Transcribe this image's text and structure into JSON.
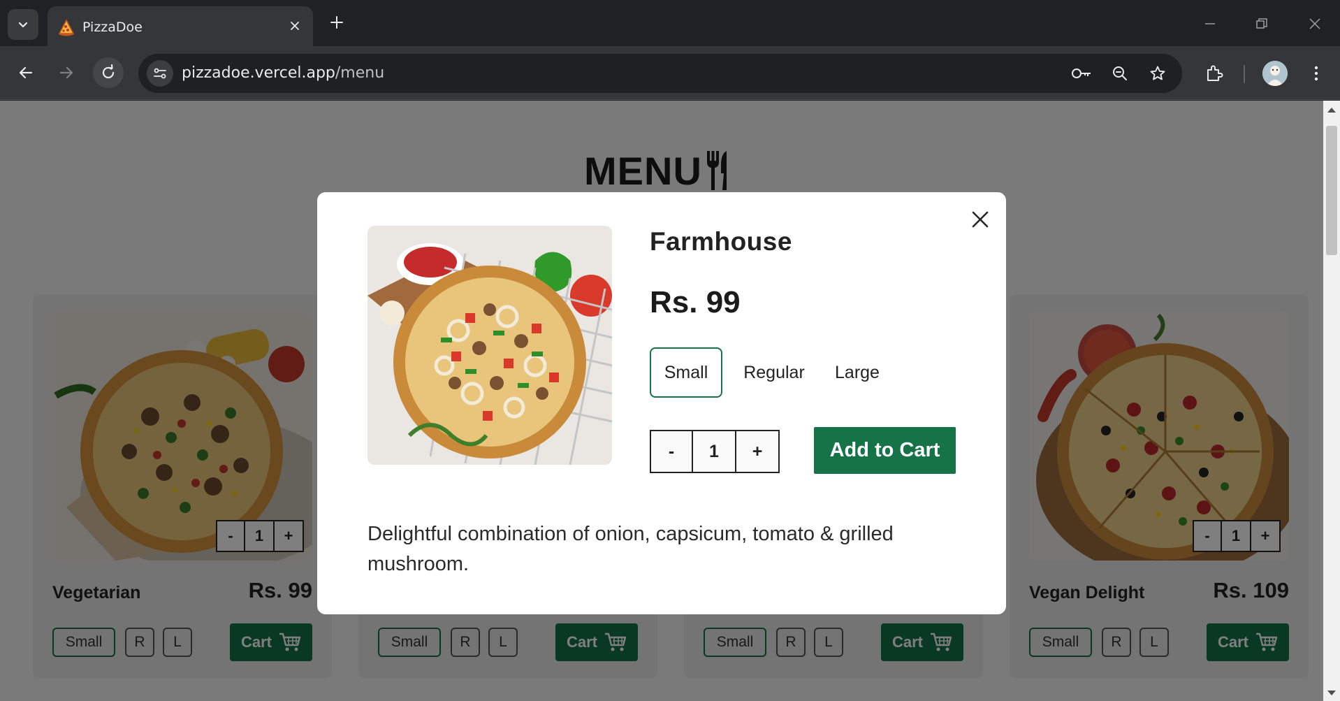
{
  "browser": {
    "tab_title": "PizzaDoe",
    "url_domain": "pizzadoe.vercel.app",
    "url_path": "/menu",
    "icons": [
      "tab-list-icon",
      "pizza-favicon",
      "close-icon",
      "plus-icon",
      "minimize-icon",
      "restore-icon",
      "window-close-icon",
      "back-arrow-icon",
      "forward-arrow-icon",
      "reload-icon",
      "site-settings-icon",
      "key-icon",
      "zoom-icon",
      "star-icon",
      "extensions-icon",
      "kebab-menu-icon"
    ]
  },
  "page": {
    "heading": "MENU",
    "heading_icon": "fork-knife-icon"
  },
  "cards": [
    {
      "name": "Vegetarian",
      "price": "Rs. 99",
      "qty": "1",
      "minus": "-",
      "plus": "+",
      "size_small": "Small",
      "size_r": "R",
      "size_l": "L",
      "cart": "Cart"
    },
    {
      "name": "",
      "price": "",
      "qty": "",
      "minus": "",
      "plus": "",
      "size_small": "Small",
      "size_r": "R",
      "size_l": "L",
      "cart": "Cart"
    },
    {
      "name": "",
      "price": "",
      "qty": "",
      "minus": "",
      "plus": "",
      "size_small": "Small",
      "size_r": "R",
      "size_l": "L",
      "cart": "Cart"
    },
    {
      "name": "Vegan Delight",
      "price": "Rs. 109",
      "qty": "1",
      "minus": "-",
      "plus": "+",
      "size_small": "Small",
      "size_r": "R",
      "size_l": "L",
      "cart": "Cart"
    }
  ],
  "modal": {
    "title": "Farmhouse",
    "price": "Rs. 99",
    "sizes": [
      "Small",
      "Regular",
      "Large"
    ],
    "selected_size": "Small",
    "minus": "-",
    "qty": "1",
    "plus": "+",
    "add_to_cart": "Add to Cart",
    "description": "Delightful combination of onion, capsicum, tomato & grilled mushroom."
  },
  "colors": {
    "brand_green": "#157347",
    "chrome_dark": "#202124",
    "chrome_toolbar": "#35363a"
  }
}
